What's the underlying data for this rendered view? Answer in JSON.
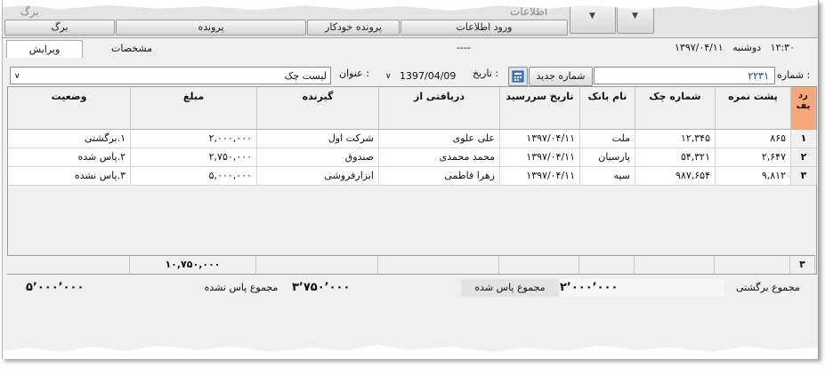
{
  "ribbon": {
    "faint_1": "برگ",
    "faint_2": "اطلاعات",
    "buttons": [
      "برگ",
      "پرونده",
      "پرونده خودکار",
      "ورود اطلاعات"
    ]
  },
  "tabs": {
    "edit": "ویرایش",
    "specs": "مشخصات",
    "dash": "----"
  },
  "header_info": {
    "time": "۱۲:۳۰",
    "day": "دوشنبه",
    "date": "۱۳۹۷/۰۴/۱۱"
  },
  "form": {
    "number_label": "شماره :",
    "number_value": "۲۲۳۱",
    "new_number_button": "شماره جدید",
    "date_label": "تاریخ :",
    "date_value": "1397/04/09",
    "title_label": "عنوان :",
    "title_value": "لیست چک"
  },
  "table": {
    "columns": {
      "radif": "رد یف",
      "pusht": "پشت نمره",
      "cheque": "شماره چک",
      "bank": "نام بانک",
      "due": "تاریخ سررسید",
      "from": "دریافتی از",
      "receiver": "گیرنده",
      "amount": "مبلغ",
      "status": "وضعیت"
    },
    "rows": [
      {
        "n": "۱",
        "pusht": "۸۶۵",
        "cheque": "۱۲,۳۴۵",
        "bank": "ملت",
        "due": "۱۳۹۷/۰۴/۱۱",
        "from": "علی علوی",
        "receiver": "شرکت اول",
        "amount": "۲,۰۰۰,۰۰۰",
        "status": "۱.برگشتی"
      },
      {
        "n": "۲",
        "pusht": "۲,۶۴۷",
        "cheque": "۵۴,۳۲۱",
        "bank": "پارسیان",
        "due": "۱۳۹۷/۰۴/۱۱",
        "from": "محمد محمدی",
        "receiver": "صندوق",
        "amount": "۲,۷۵۰,۰۰۰",
        "status": "۲.پاس شده"
      },
      {
        "n": "۳",
        "pusht": "۹,۸۱۲",
        "cheque": "۹۸۷,۶۵۴",
        "bank": "سپه",
        "due": "۱۳۹۷/۰۴/۱۱",
        "from": "زهرا فاطمی",
        "receiver": "ابزارفروشی",
        "amount": "۵,۰۰۰,۰۰۰",
        "status": "۳.پاس نشده"
      }
    ]
  },
  "footer": {
    "count": "۳",
    "total": "۱۰,۷۵۰,۰۰۰"
  },
  "summary": {
    "returned_label": "مجموع برگشتی",
    "returned_value": "۲٬۰۰۰٬۰۰۰",
    "passed_label": "مجموع پاس شده",
    "passed_value": "۳٬۷۵۰٬۰۰۰",
    "unpassed_label": "مجموع پاس نشده",
    "unpassed_value": "۵٬۰۰۰٬۰۰۰"
  },
  "colors": {
    "radif_header": "#f7a77a",
    "window_bg": "#f0f0f0"
  }
}
